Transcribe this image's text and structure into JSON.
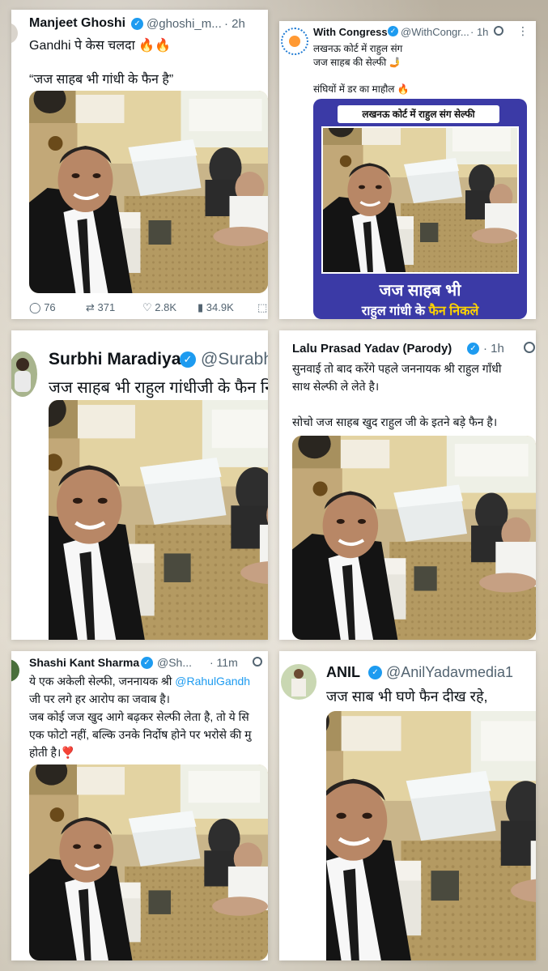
{
  "colors": {
    "verified": "#1d9bf0",
    "text": "#0f1419",
    "muted": "#536471",
    "mention": "#1d9bf0",
    "banner": "#3b3aa6",
    "banner_highlight": "#ffd400"
  },
  "tweet1": {
    "name": "Manjeet Ghoshi",
    "handle": "@ghoshi_m...",
    "time": "· 2h",
    "line1": "Gandhi पे केस चलदा 🔥🔥",
    "quote": "“जज साहब भी गांधी के फैन है”",
    "actions": {
      "replies": "76",
      "reposts": "371",
      "likes": "2.8K",
      "views": "34.9K"
    },
    "icons": [
      "reply-icon",
      "repost-icon",
      "like-icon",
      "views-icon",
      "bookmark-icon"
    ]
  },
  "tweet2": {
    "name": "With Congress",
    "handle": "@WithCongr...",
    "time": "· 1h",
    "line1": "लखनऊ कोर्ट में राहुल संग",
    "line2": "जज साहब की सेल्फी 🤳",
    "line3": "संघियों में डर का माहौल 🔥",
    "banner_top": "लखनऊ कोर्ट में राहुल संग सेल्फी",
    "banner_line1": "जज साहब भी",
    "banner_line2_a": "राहुल गांधी के ",
    "banner_line2_b": "फैन निकले"
  },
  "tweet3": {
    "name": "Surbhi Maradiya",
    "handle": "@Surabh",
    "line1": "जज साहब भी राहुल गांधीजी के फैन नि"
  },
  "tweet4": {
    "name": "Lalu Prasad Yadav (Parody)",
    "time": "· 1h",
    "line1": "सुनवाई तो बाद करेंगे पहले जननायक श्री राहुल गाँधी",
    "line2": "साथ सेल्फी ले लेते है।",
    "line3": "सोचो जज साहब खुद राहुल जी के इतने बड़े फैन है।"
  },
  "tweet5": {
    "name": "Shashi Kant Sharma",
    "handle": "@Sh...",
    "time": "· 11m",
    "line1a": "ये एक अकेली सेल्फी, जननायक श्री ",
    "mention": "@RahulGandh",
    "line2": "जी पर लगे हर आरोप का जवाब है।",
    "line3": "जब कोई जज खुद आगे बढ़कर सेल्फी लेता है, तो ये सि",
    "line4": "एक फोटो नहीं, बल्कि उनके निर्दोष होने पर भरोसे की मु",
    "line5": "होती है।❣️"
  },
  "tweet6": {
    "name": "ANIL",
    "handle": "@AnilYadavmedia1",
    "line1": "जज साब भी घणे फैन दीख रहे,"
  }
}
